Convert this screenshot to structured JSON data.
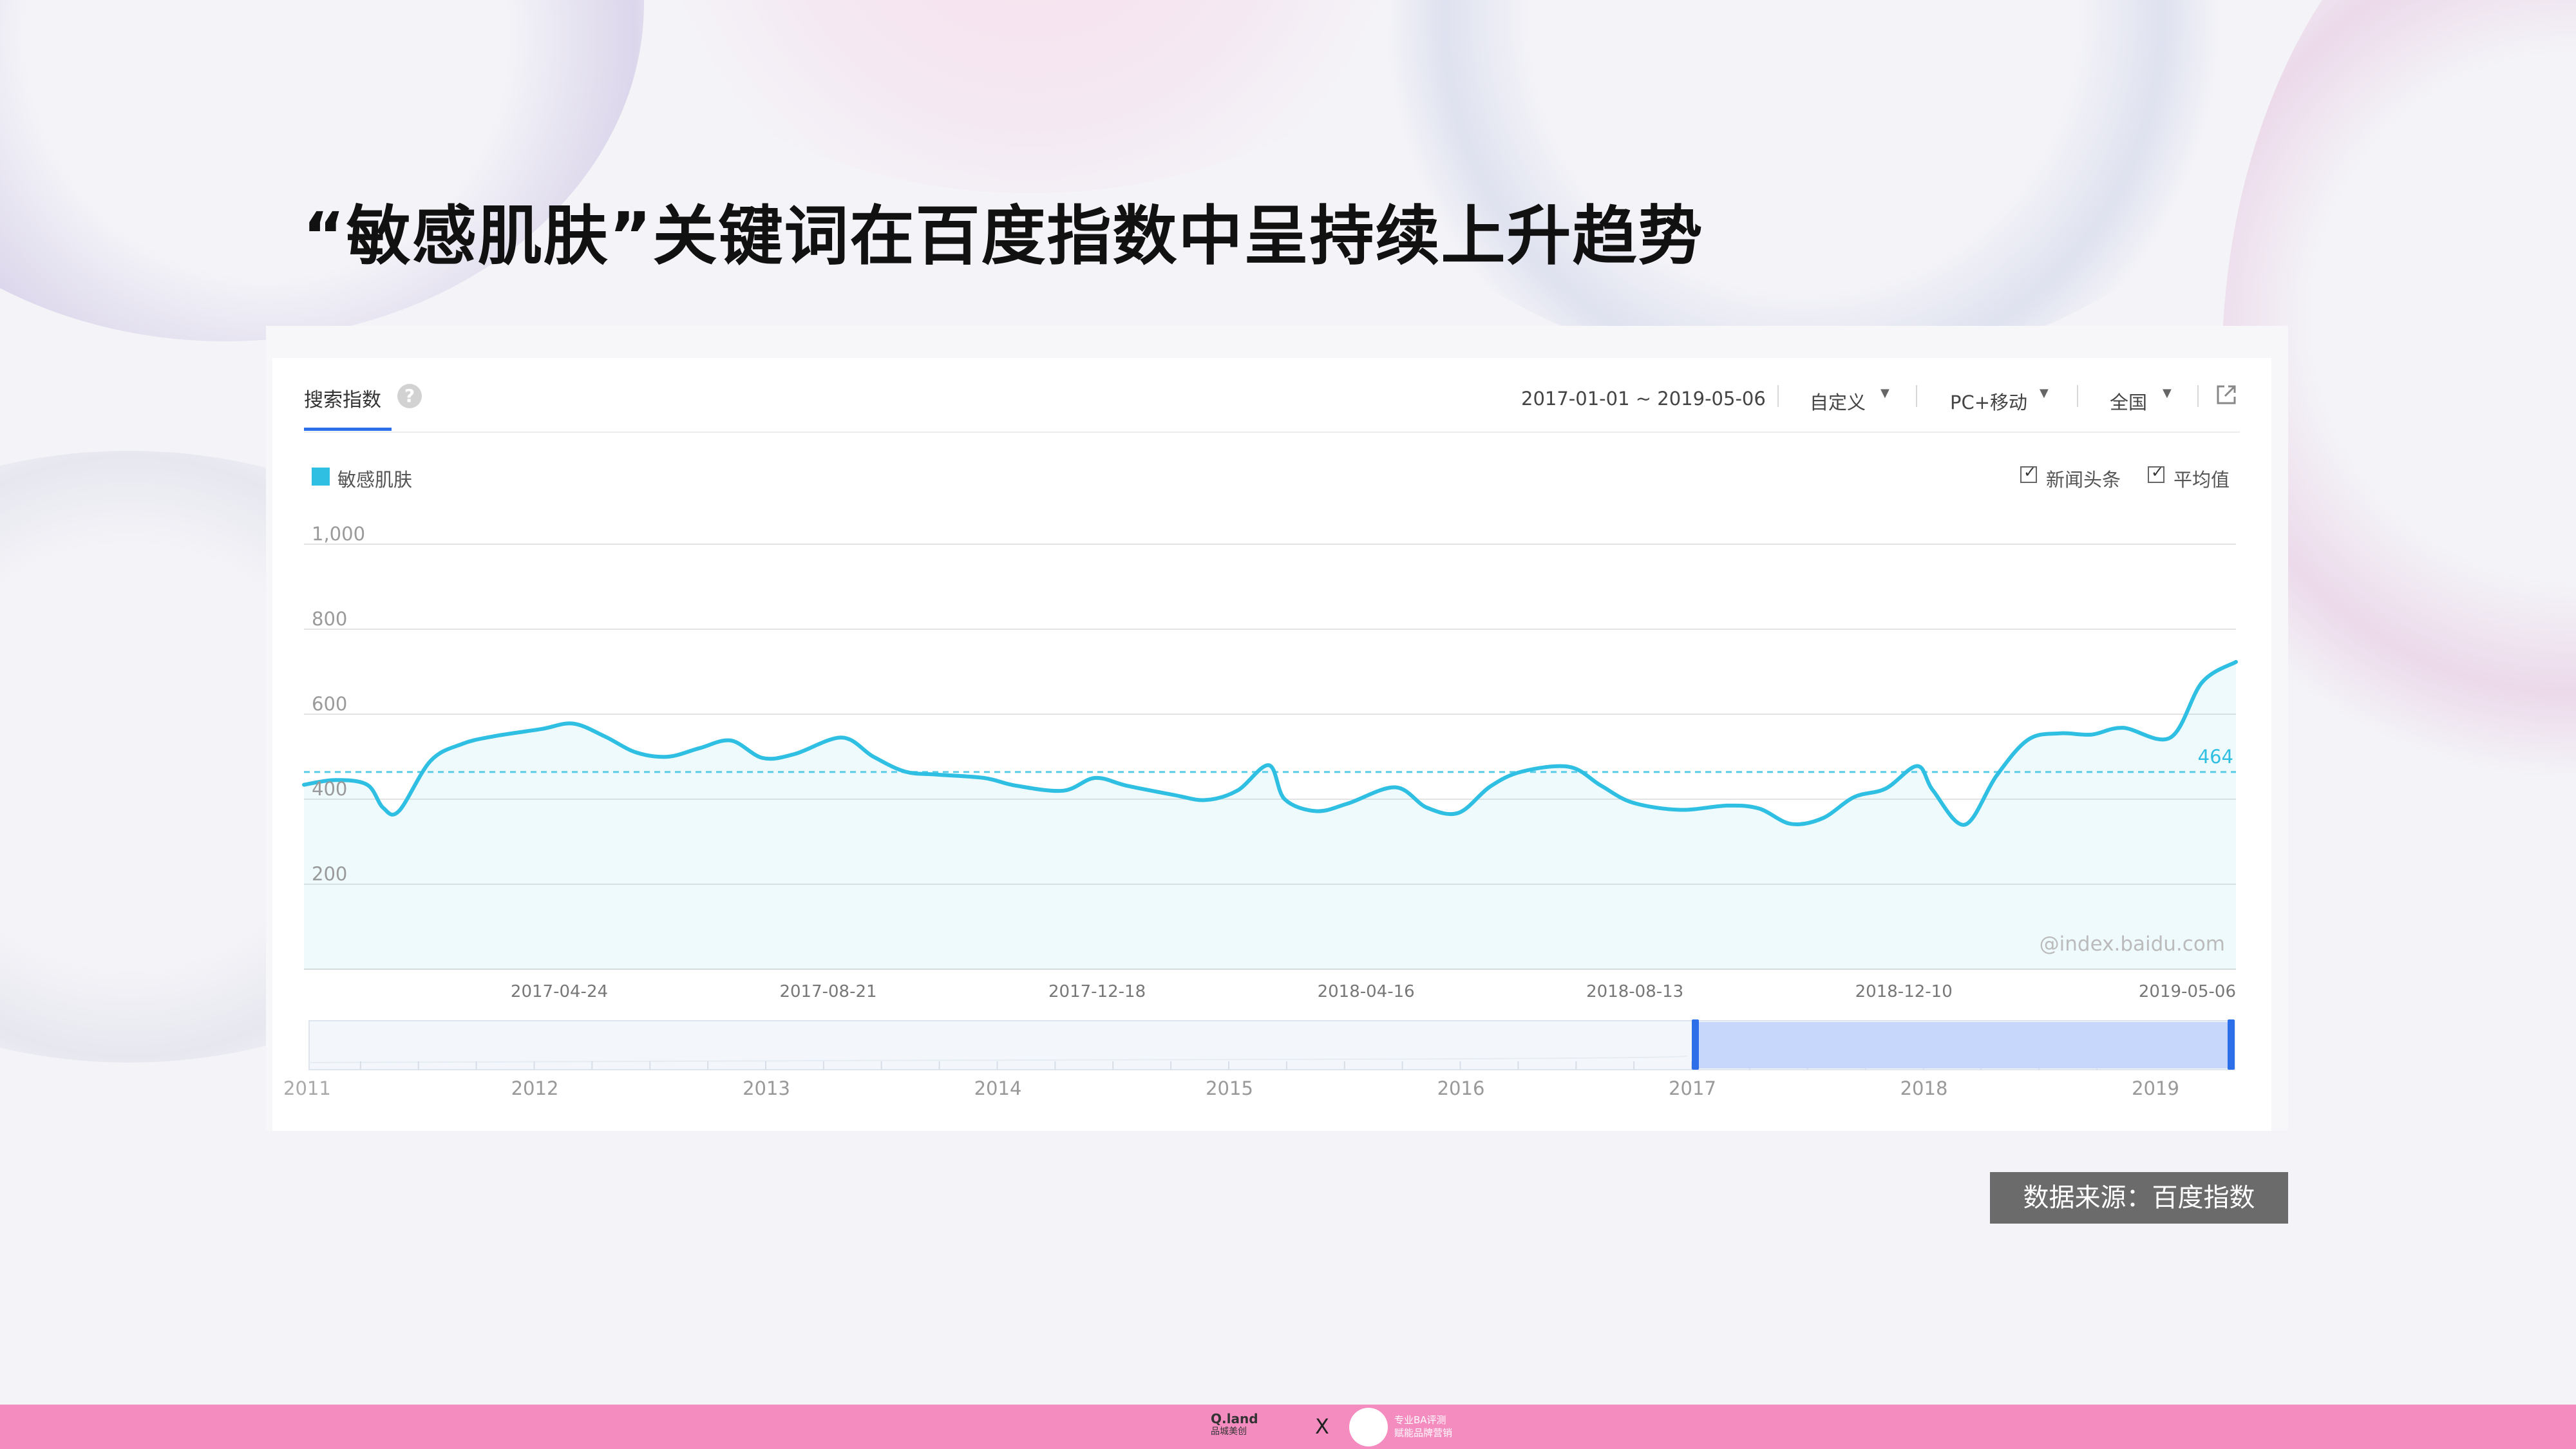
{
  "page": {
    "title": "“敏感肌肤”关键词在百度指数中呈持续上升趋势",
    "source_label": "数据来源：百度指数"
  },
  "toolbar": {
    "tab_label": "搜索指数",
    "help_icon": "?",
    "date_range": "2017-01-01 ~ 2019-05-06",
    "custom_label": "自定义",
    "device_label": "PC+移动",
    "region_label": "全国",
    "export_icon": "external-link-icon"
  },
  "legend": {
    "series_label": "敏感肌肤",
    "checkbox_news": "新闻头条",
    "checkbox_average": "平均值"
  },
  "footer": {
    "logo_left_line1": "Q.land",
    "logo_left_line2": "品城美创",
    "separator": "X",
    "logo_right_line1": "专业BA评测",
    "logo_right_line2": "赋能品牌营销"
  },
  "colors": {
    "series": "#2fbfe2",
    "accent": "#2d6fe8",
    "footer": "#f58cc0"
  },
  "chart_data": {
    "type": "area",
    "series": [
      {
        "name": "敏感肌肤",
        "values": [
          {
            "x": "2017-01-01",
            "y": 434
          },
          {
            "x": "2017-01-15",
            "y": 445
          },
          {
            "x": "2017-01-29",
            "y": 434
          },
          {
            "x": "2017-02-05",
            "y": 380
          },
          {
            "x": "2017-02-12",
            "y": 372
          },
          {
            "x": "2017-02-26",
            "y": 490
          },
          {
            "x": "2017-03-12",
            "y": 530
          },
          {
            "x": "2017-03-26",
            "y": 548
          },
          {
            "x": "2017-04-16",
            "y": 565
          },
          {
            "x": "2017-04-30",
            "y": 578
          },
          {
            "x": "2017-05-14",
            "y": 548
          },
          {
            "x": "2017-05-28",
            "y": 510
          },
          {
            "x": "2017-06-11",
            "y": 500
          },
          {
            "x": "2017-06-25",
            "y": 520
          },
          {
            "x": "2017-07-09",
            "y": 538
          },
          {
            "x": "2017-07-23",
            "y": 497
          },
          {
            "x": "2017-08-06",
            "y": 506
          },
          {
            "x": "2017-08-27",
            "y": 545
          },
          {
            "x": "2017-09-10",
            "y": 500
          },
          {
            "x": "2017-09-24",
            "y": 465
          },
          {
            "x": "2017-10-08",
            "y": 458
          },
          {
            "x": "2017-10-29",
            "y": 450
          },
          {
            "x": "2017-11-12",
            "y": 432
          },
          {
            "x": "2017-12-03",
            "y": 420
          },
          {
            "x": "2017-12-17",
            "y": 450
          },
          {
            "x": "2017-12-31",
            "y": 432
          },
          {
            "x": "2018-01-21",
            "y": 410
          },
          {
            "x": "2018-02-04",
            "y": 398
          },
          {
            "x": "2018-02-18",
            "y": 420
          },
          {
            "x": "2018-03-04",
            "y": 480
          },
          {
            "x": "2018-03-11",
            "y": 400
          },
          {
            "x": "2018-03-25",
            "y": 372
          },
          {
            "x": "2018-04-08",
            "y": 390
          },
          {
            "x": "2018-04-29",
            "y": 428
          },
          {
            "x": "2018-05-13",
            "y": 380
          },
          {
            "x": "2018-05-27",
            "y": 368
          },
          {
            "x": "2018-06-10",
            "y": 430
          },
          {
            "x": "2018-06-24",
            "y": 465
          },
          {
            "x": "2018-07-15",
            "y": 476
          },
          {
            "x": "2018-07-29",
            "y": 432
          },
          {
            "x": "2018-08-12",
            "y": 392
          },
          {
            "x": "2018-09-02",
            "y": 375
          },
          {
            "x": "2018-09-23",
            "y": 385
          },
          {
            "x": "2018-10-07",
            "y": 378
          },
          {
            "x": "2018-10-21",
            "y": 342
          },
          {
            "x": "2018-11-04",
            "y": 355
          },
          {
            "x": "2018-11-18",
            "y": 405
          },
          {
            "x": "2018-12-02",
            "y": 425
          },
          {
            "x": "2018-12-16",
            "y": 478
          },
          {
            "x": "2018-12-23",
            "y": 420
          },
          {
            "x": "2019-01-06",
            "y": 340
          },
          {
            "x": "2019-01-20",
            "y": 455
          },
          {
            "x": "2019-02-03",
            "y": 540
          },
          {
            "x": "2019-02-17",
            "y": 555
          },
          {
            "x": "2019-03-03",
            "y": 552
          },
          {
            "x": "2019-03-17",
            "y": 568
          },
          {
            "x": "2019-04-07",
            "y": 545
          },
          {
            "x": "2019-04-21",
            "y": 675
          },
          {
            "x": "2019-05-06",
            "y": 723
          }
        ]
      }
    ],
    "y_ticks": [
      "1,000",
      "800",
      "600",
      "400",
      "200"
    ],
    "x_ticks": [
      "2017-04-24",
      "2017-08-21",
      "2017-12-18",
      "2018-04-16",
      "2018-08-13",
      "2018-12-10",
      "2019-05-06"
    ],
    "ylim": [
      0,
      1000
    ],
    "average": 464,
    "average_label": "464",
    "watermark": "@index.baidu.com",
    "grid": true,
    "overview": {
      "year_labels": [
        "2011",
        "2012",
        "2013",
        "2014",
        "2015",
        "2016",
        "2017",
        "2018",
        "2019"
      ],
      "selected_range": [
        "2017-01-01",
        "2019-05-06"
      ]
    }
  }
}
